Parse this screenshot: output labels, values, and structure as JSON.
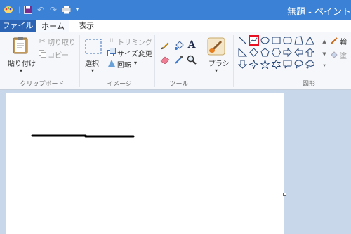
{
  "app": {
    "title": "無題 - ペイント"
  },
  "tabs": {
    "file": "ファイル",
    "home": "ホーム",
    "view": "表示"
  },
  "clipboard": {
    "paste": "貼り付け",
    "cut": "切り取り",
    "copy": "コピー",
    "group": "クリップボード"
  },
  "image": {
    "select": "選択",
    "crop": "トリミング",
    "resize": "サイズ変更",
    "rotate": "回転",
    "group": "イメージ"
  },
  "tools": {
    "group": "ツール"
  },
  "brushes": {
    "label": "ブラシ"
  },
  "shapes": {
    "group": "図形",
    "outline": "輪",
    "fill": "塗",
    "selected": "curve-shape",
    "items": [
      "line",
      "curve",
      "oval",
      "rectangle",
      "rounded-rectangle",
      "polygon",
      "triangle",
      "right-triangle",
      "diamond",
      "pentagon",
      "hexagon",
      "right-arrow",
      "left-arrow",
      "up-arrow",
      "down-arrow",
      "four-point-star",
      "five-point-star",
      "six-point-star",
      "rounded-callout",
      "oval-callout",
      "cloud-callout"
    ]
  },
  "colors": {
    "titlebar": "#3b82d6",
    "file_tab": "#2b64b4",
    "highlight": "#e81123",
    "stroke": "#000000"
  }
}
